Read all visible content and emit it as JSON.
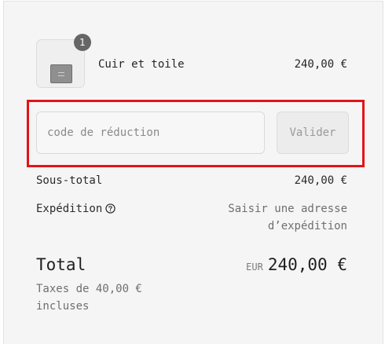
{
  "cart": {
    "item": {
      "name": "Cuir et toile",
      "price": "240,00 €",
      "quantity": "1"
    }
  },
  "discount": {
    "placeholder": "code de réduction",
    "apply_label": "Valider"
  },
  "summary": {
    "subtotal_label": "Sous-total",
    "subtotal_value": "240,00 €",
    "shipping_label": "Expédition",
    "shipping_value": "Saisir une adresse d’expédition",
    "total_label": "Total",
    "currency": "EUR",
    "total_value": "240,00 €",
    "tax_note": "Taxes de 40,00 € incluses"
  },
  "colors": {
    "highlight": "#e31318",
    "panel_background": "#f5f5f5",
    "badge": "#666666"
  },
  "icons": {
    "shipping_help": "help-circle-icon"
  }
}
